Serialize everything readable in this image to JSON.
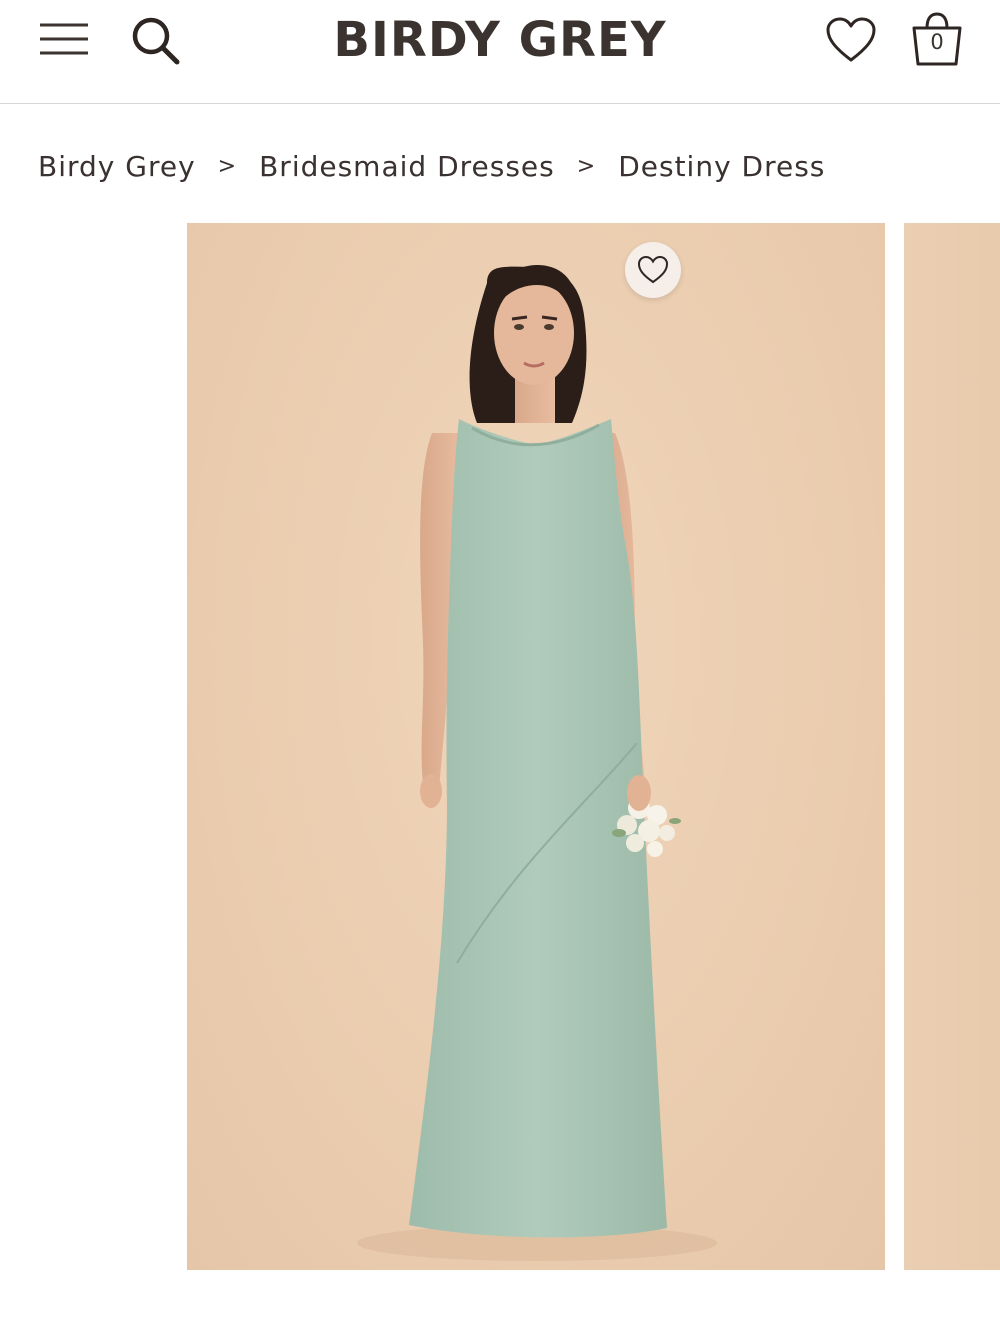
{
  "header": {
    "brand": "BIRDY GREY",
    "menu_icon": "hamburger-menu-icon",
    "search_icon": "search-icon",
    "wishlist_icon": "heart-icon",
    "bag_icon": "shopping-bag-icon",
    "bag_count": "0"
  },
  "breadcrumb": {
    "items": [
      "Birdy Grey",
      "Bridesmaid Dresses",
      "Destiny Dress"
    ],
    "separator": ">"
  },
  "product": {
    "image_alt_icon": "product-photo",
    "favorite_icon": "heart-outline-icon"
  },
  "colors": {
    "text": "#3a3230",
    "backdrop": "#ebcdb0",
    "dress": "#a9c6b5",
    "border": "#d9d6d4"
  }
}
